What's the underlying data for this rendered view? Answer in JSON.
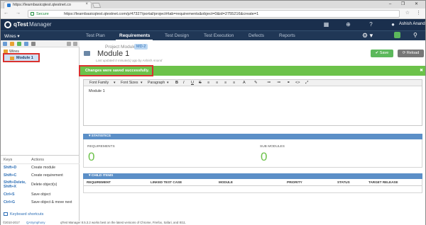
{
  "browser": {
    "tab_title": "https://learnbasicqtest.qtestnet.co",
    "tab_close": "×",
    "window_controls": "– ❐ ✕",
    "nav_icons": "← → C",
    "security_label": "Secure",
    "url": "https://learnbasicqtest.qtestnet.com/p/47327/portal/project#tab=requirements&object=0&id=2755216&create=1",
    "star": "☆",
    "menu": "⋮"
  },
  "app": {
    "brand": "qTest",
    "brand_sub": "Manager",
    "user_name": "Ashish Anand",
    "icons": [
      "grid-icon",
      "download-icon",
      "help-icon",
      "user-icon"
    ]
  },
  "nav": {
    "project": "Wires ▾",
    "tabs": [
      "Test Plan",
      "Requirements",
      "Test Design",
      "Test Execution",
      "Defects",
      "Reports"
    ],
    "active_tab": "Requirements",
    "gear": "⚙ ▾",
    "search": "⚲"
  },
  "tree": {
    "root": "Wires",
    "module": "Module 1"
  },
  "shortcuts": {
    "header_keys": "Keys",
    "header_actions": "Actions",
    "rows": [
      {
        "key": "Shift+D",
        "action": "Create module"
      },
      {
        "key": "Shift+C",
        "action": "Create requirement"
      },
      {
        "key": "Shift+Delete,\nShift+X",
        "action": "Delete object(s)"
      },
      {
        "key": "Ctrl+S",
        "action": "Save object"
      },
      {
        "key": "Ctrl+G",
        "action": "Save object & move next"
      }
    ],
    "footer_link": "Keyboard shortcuts"
  },
  "module": {
    "breadcrumb": "Project Module",
    "id_badge": "MD-2",
    "title": "Module 1",
    "last_updated": "Last updated 0 minute(s) ago by Ashish Anand",
    "save_label": "✔ Save",
    "reload_label": "⟳ Reload"
  },
  "banner": {
    "message": "Changes were saved successfully.",
    "close": "✖"
  },
  "editor": {
    "font_family": "Font Family",
    "font_sizes": "Font Sizes",
    "paragraph": "Paragraph",
    "buttons": [
      "B",
      "I",
      "U",
      "S",
      "≡",
      "≡",
      "≡",
      "≡",
      "A",
      "✎",
      "≔",
      "≔",
      "⚭",
      "<>",
      "⤢"
    ],
    "body": "Module 1"
  },
  "statistics": {
    "header": "▾ STATISTICS",
    "requirements_label": "REQUIREMENTS",
    "requirements_value": "0",
    "submodules_label": "SUB MODULES",
    "submodules_value": "0"
  },
  "child_items": {
    "header": "▾ CHILD ITEMS",
    "columns": [
      "REQUIREMENT",
      "LINKED TEST CASE",
      "MODULE",
      "PRIORITY",
      "STATUS",
      "TARGET RELEASE"
    ]
  },
  "footer": {
    "copyright": "©2010-2017",
    "company": "QASymphony",
    "note": "qTest Manager 8.5.3.2 works best on the latest versions of Chrome, Firefox, Safari, and IE11."
  }
}
